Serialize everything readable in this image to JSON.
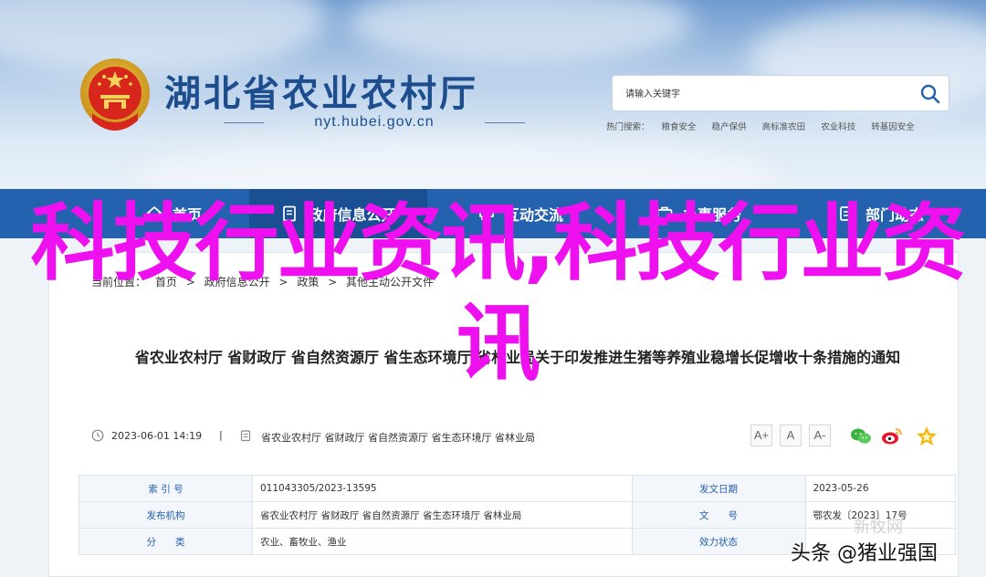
{
  "header": {
    "title": "湖北省农业农村厅",
    "url": "nyt.hubei.gov.cn",
    "search_placeholder": "请输入关键字",
    "hot_label": "热门搜索：",
    "hot_terms": [
      "粮食安全",
      "稳产保供",
      "高标准农田",
      "农业科技",
      "转基因安全"
    ]
  },
  "nav": {
    "items": [
      "首页",
      "政府信息公开",
      "互动交流",
      "办事服务",
      "部门动态"
    ]
  },
  "breadcrumb": {
    "label": "当前位置：",
    "items": [
      "首页",
      "政府信息公开",
      "政策",
      "其他主动公开文件"
    ],
    "separator": ">"
  },
  "article": {
    "title": "省农业农村厅 省财政厅 省自然资源厅 省生态环境厅 省林业局关于印发推进生猪等养殖业稳增长促增收十条措施的通知",
    "date": "2023-06-01 14:19",
    "separator": "|",
    "source": "省农业农村厅 省财政厅 省自然资源厅 省生态环境厅 省林业局",
    "font_buttons": [
      "A+",
      "A",
      "A-"
    ],
    "share_icons": [
      "wechat-icon",
      "weibo-icon",
      "favorite-icon"
    ]
  },
  "meta_table": [
    {
      "k1": "索 引 号",
      "v1": "011043305/2023-13595",
      "k2": "发文日期",
      "v2": "2023-05-26"
    },
    {
      "k1": "发布机构",
      "v1": "省农业农村厅 省财政厅 省自然资源厅 省生态环境厅 省林业局",
      "k2": "文　　号",
      "v2": "鄂农发〔2023〕17号"
    },
    {
      "k1": "分　　类",
      "v1": "农业、畜牧业、渔业",
      "k2": "效力状态",
      "v2": ""
    }
  ],
  "overlay": {
    "text": "科技行业资讯,科技行业资讯"
  },
  "watermark": "新牧网",
  "credit": "头条 @猪业强国",
  "colors": {
    "nav_bg": "#2461ae",
    "title_blue": "#1d4d8d",
    "overlay_magenta": "#ee10ee"
  }
}
